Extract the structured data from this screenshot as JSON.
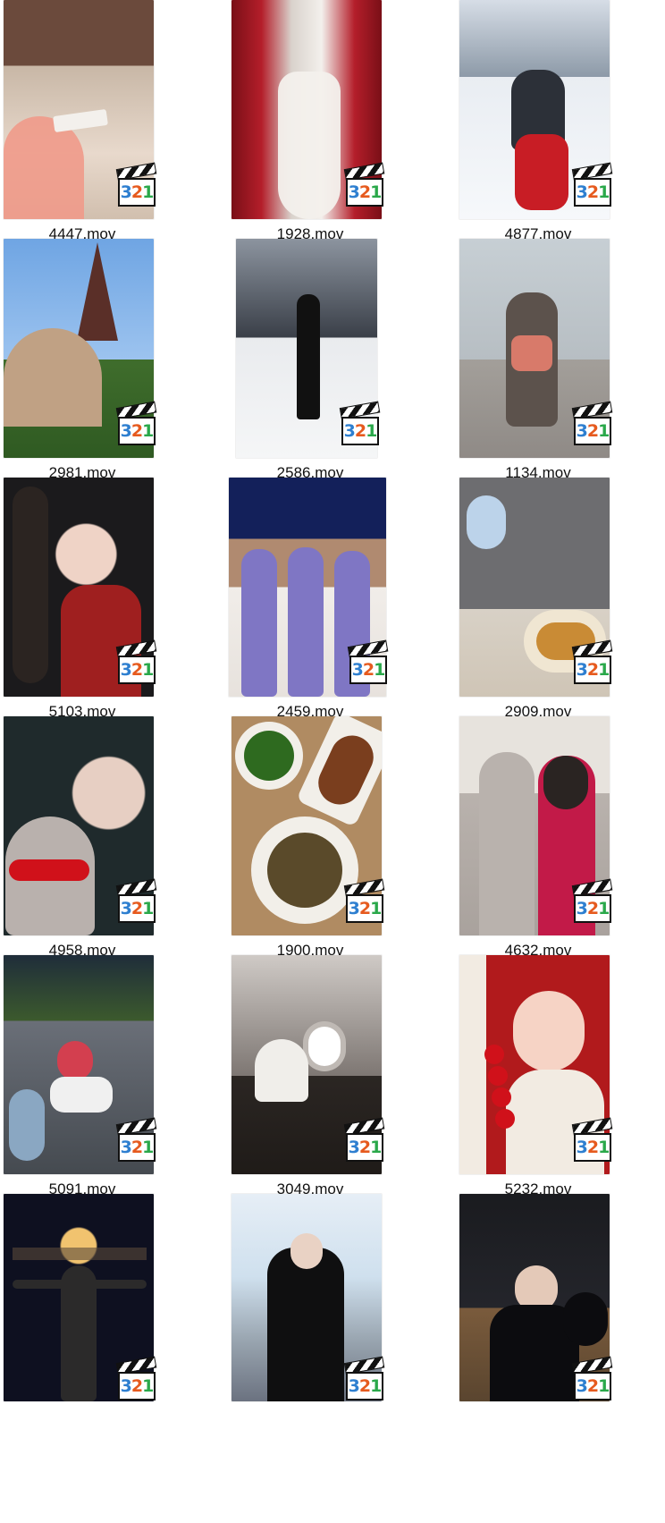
{
  "badge": {
    "digits": [
      "3",
      "2",
      "1"
    ]
  },
  "items": [
    {
      "name": "4447.mov",
      "icon": "media-player-classic-icon",
      "palette": [
        "#6b4a3c",
        "#c8b7a6",
        "#e8d9cc",
        "#ef9a8a"
      ]
    },
    {
      "name": "1928.mov",
      "icon": "media-player-classic-icon",
      "palette": [
        "#7a0f17",
        "#b41e2a",
        "#d9d2cc",
        "#f3f0ec"
      ]
    },
    {
      "name": "4877.mov",
      "icon": "media-player-classic-icon",
      "palette": [
        "#e9edf2",
        "#8d9aa8",
        "#2c3038",
        "#c81d25"
      ]
    },
    {
      "name": "2981.mov",
      "icon": "media-player-classic-icon",
      "palette": [
        "#6fa5e3",
        "#5a2f28",
        "#c0a184",
        "#3f6d2c"
      ]
    },
    {
      "name": "2586.mov",
      "icon": "media-player-classic-icon",
      "palette": [
        "#8c949f",
        "#3a3f48",
        "#e9ebee",
        "#111111"
      ]
    },
    {
      "name": "1134.mov",
      "icon": "media-player-classic-icon",
      "palette": [
        "#c7cfd4",
        "#a39f9a",
        "#d87a6a",
        "#5c524c"
      ]
    },
    {
      "name": "5103.mov",
      "icon": "media-player-classic-icon",
      "palette": [
        "#1b1a1c",
        "#efd3c6",
        "#9f1f1f",
        "#4a3a2a"
      ]
    },
    {
      "name": "2459.mov",
      "icon": "media-player-classic-icon",
      "palette": [
        "#13205a",
        "#f1ede9",
        "#7f76c4",
        "#b08a70"
      ]
    },
    {
      "name": "2909.mov",
      "icon": "media-player-classic-icon",
      "palette": [
        "#6d6d70",
        "#bcd3ea",
        "#f0e6d2",
        "#c98b35"
      ]
    },
    {
      "name": "4958.mov",
      "icon": "media-player-classic-icon",
      "palette": [
        "#1f2a2c",
        "#e7cfc3",
        "#d0111a",
        "#b9b1ad"
      ]
    },
    {
      "name": "1900.mov",
      "icon": "media-player-classic-icon",
      "palette": [
        "#b08b62",
        "#f2efe9",
        "#2e6a1f",
        "#7a3e1e"
      ]
    },
    {
      "name": "4632.mov",
      "icon": "media-player-classic-icon",
      "palette": [
        "#e7e3dd",
        "#b9b2ad",
        "#c21a48",
        "#2a2422"
      ]
    },
    {
      "name": "5091.mov",
      "icon": "media-player-classic-icon",
      "palette": [
        "#1f2d3a",
        "#3c5a2d",
        "#6a6f78",
        "#d33f4f"
      ]
    },
    {
      "name": "3049.mov",
      "icon": "media-player-classic-icon",
      "palette": [
        "#cfcac6",
        "#7e7773",
        "#2b2623",
        "#ffffff"
      ]
    },
    {
      "name": "5232.mov",
      "icon": "media-player-classic-icon",
      "palette": [
        "#b11a1c",
        "#f2ebe2",
        "#d0111a",
        "#f6d3c5"
      ]
    },
    {
      "name": "",
      "icon": "media-player-classic-icon",
      "palette": [
        "#0e1020",
        "#f1c36f",
        "#2b2a2a",
        "#5a4a3a"
      ]
    },
    {
      "name": "",
      "icon": "media-player-classic-icon",
      "palette": [
        "#cfe0ee",
        "#9aa6b1",
        "#0f0f10",
        "#6b7280"
      ]
    },
    {
      "name": "",
      "icon": "media-player-classic-icon",
      "palette": [
        "#1a1b1f",
        "#e4c9b8",
        "#0c0c0f",
        "#7a5b3c"
      ]
    }
  ]
}
